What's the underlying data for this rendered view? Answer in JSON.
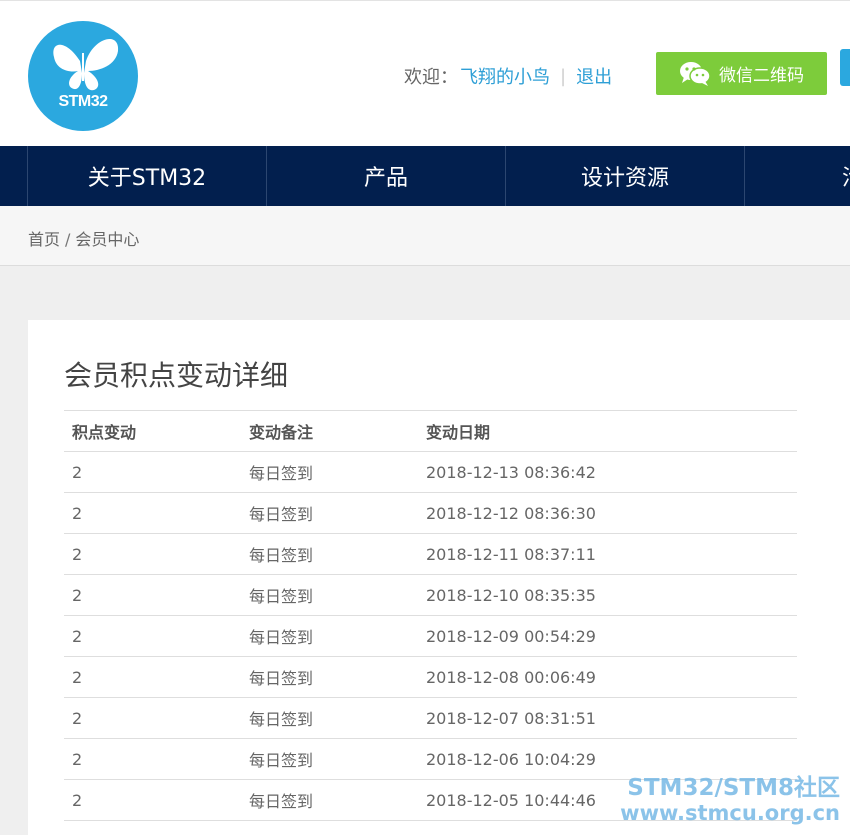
{
  "header": {
    "logo_text": "STM32",
    "welcome_label": "欢迎：",
    "username": "飞翔的小鸟",
    "separator": "|",
    "logout": "退出",
    "wechat_button": "微信二维码"
  },
  "nav": {
    "items": [
      "关于STM32",
      "产品",
      "设计资源",
      "活动"
    ]
  },
  "breadcrumb": {
    "home": "首页",
    "separator": "/",
    "current": "会员中心"
  },
  "panel": {
    "title": "会员积点变动详细",
    "columns": [
      "积点变动",
      "变动备注",
      "变动日期"
    ],
    "rows": [
      [
        "2",
        "每日签到",
        "2018-12-13 08:36:42"
      ],
      [
        "2",
        "每日签到",
        "2018-12-12 08:36:30"
      ],
      [
        "2",
        "每日签到",
        "2018-12-11 08:37:11"
      ],
      [
        "2",
        "每日签到",
        "2018-12-10 08:35:35"
      ],
      [
        "2",
        "每日签到",
        "2018-12-09 00:54:29"
      ],
      [
        "2",
        "每日签到",
        "2018-12-08 00:06:49"
      ],
      [
        "2",
        "每日签到",
        "2018-12-07 08:31:51"
      ],
      [
        "2",
        "每日签到",
        "2018-12-06 10:04:29"
      ],
      [
        "2",
        "每日签到",
        "2018-12-05 10:44:46"
      ]
    ]
  },
  "watermark": {
    "line1": "STM32/STM8社区",
    "line2": "www.stmcu.org.cn"
  },
  "colors": {
    "nav_bg": "#021f4e",
    "accent_blue": "#2ba8df",
    "link_blue": "#2e9fd6",
    "wechat_green": "#7dcc3b"
  },
  "icons": {
    "logo": "butterfly-logo-icon",
    "wechat": "wechat-icon"
  }
}
